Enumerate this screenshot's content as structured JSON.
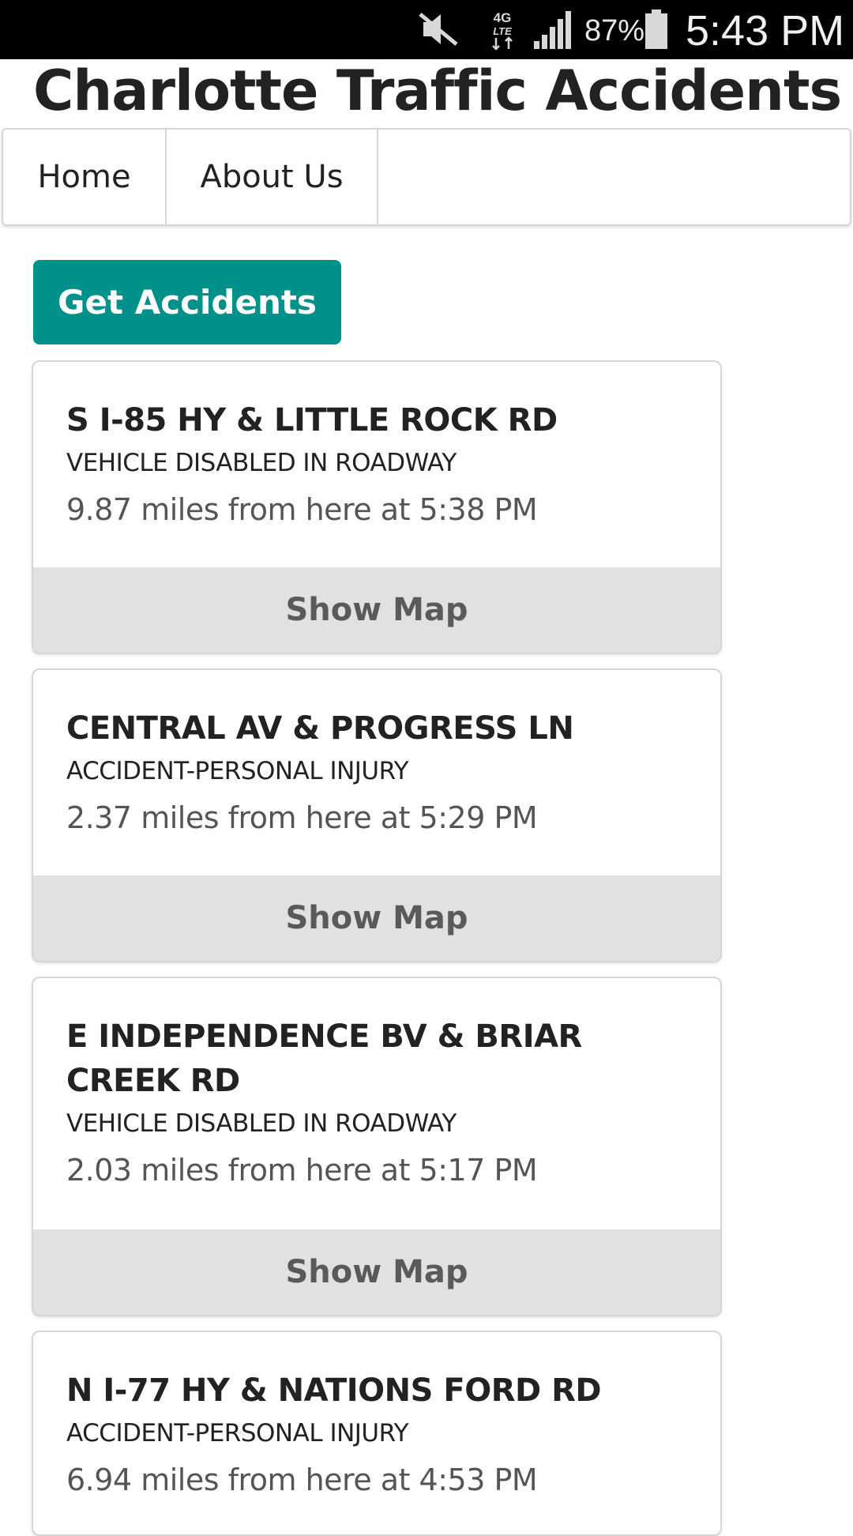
{
  "status_bar": {
    "battery": "87%",
    "time": "5:43 PM",
    "network": "4G LTE"
  },
  "header": {
    "title": "Charlotte Traffic Accidents"
  },
  "nav": {
    "items": [
      {
        "label": "Home"
      },
      {
        "label": "About Us"
      }
    ]
  },
  "actions": {
    "get_accidents_label": "Get Accidents"
  },
  "accidents": [
    {
      "location": "S I-85 HY & LITTLE ROCK RD",
      "type": "VEHICLE DISABLED IN ROADWAY",
      "meta": "9.87 miles from here at 5:38 PM",
      "action": "Show Map"
    },
    {
      "location": "CENTRAL AV & PROGRESS LN",
      "type": "ACCIDENT-PERSONAL INJURY",
      "meta": "2.37 miles from here at 5:29 PM",
      "action": "Show Map"
    },
    {
      "location": "E INDEPENDENCE BV & BRIAR CREEK RD",
      "type": "VEHICLE DISABLED IN ROADWAY",
      "meta": "2.03 miles from here at 5:17 PM",
      "action": "Show Map"
    },
    {
      "location": "N I-77 HY & NATIONS FORD RD",
      "type": "ACCIDENT-PERSONAL INJURY",
      "meta": "6.94 miles from here at 4:53 PM"
    }
  ],
  "colors": {
    "accent": "#00918a",
    "card_footer": "#e0e1e2",
    "status_bar": "#000000"
  }
}
